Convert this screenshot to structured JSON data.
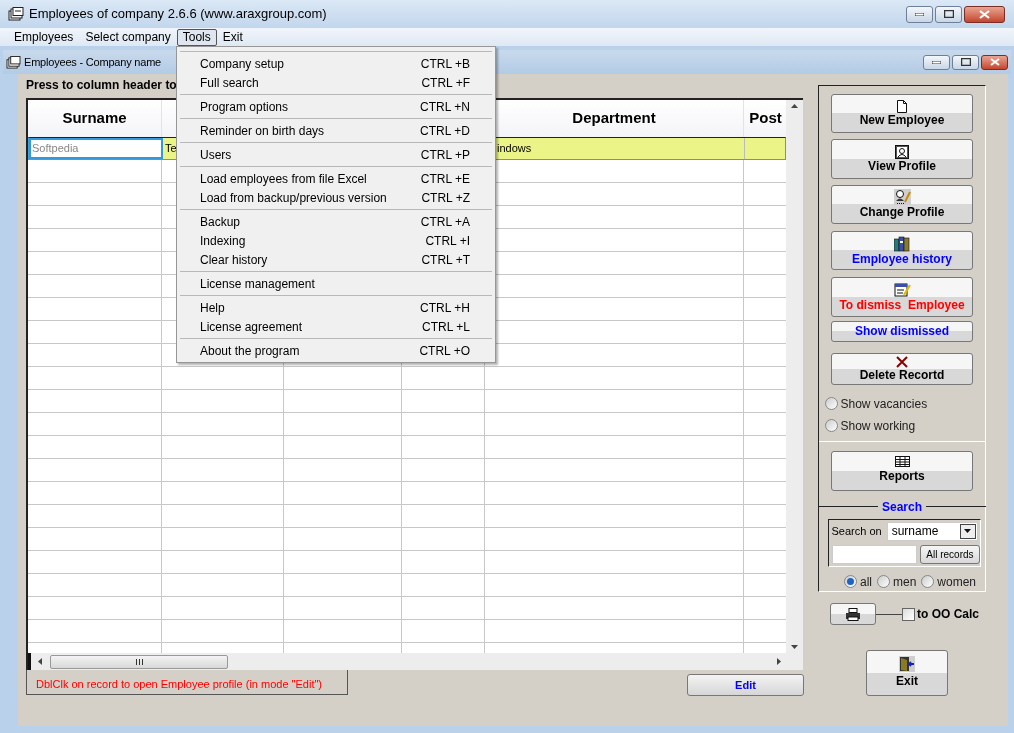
{
  "window": {
    "title": "Employees of company 2.6.6 (www.araxgroup.com)"
  },
  "menu_bar": [
    {
      "label": "Employees",
      "selected": false
    },
    {
      "label": "Select company",
      "selected": false
    },
    {
      "label": "Tools",
      "selected": true
    },
    {
      "label": "Exit",
      "selected": false
    }
  ],
  "tools_menu": {
    "groups": [
      [
        {
          "label": "Company setup",
          "shortcut": "CTRL +B"
        },
        {
          "label": "Full search",
          "shortcut": "CTRL +F"
        }
      ],
      [
        {
          "label": "Program options",
          "shortcut": "CTRL +N"
        }
      ],
      [
        {
          "label": "Reminder on birth days",
          "shortcut": "CTRL +D"
        }
      ],
      [
        {
          "label": "Users",
          "shortcut": "CTRL +P"
        }
      ],
      [
        {
          "label": "Load employees from file Excel",
          "shortcut": "CTRL +E"
        },
        {
          "label": "Load from backup/previous version",
          "shortcut": "CTRL +Z"
        }
      ],
      [
        {
          "label": "Backup",
          "shortcut": "CTRL +A"
        },
        {
          "label": "Indexing",
          "shortcut": "CTRL +I"
        },
        {
          "label": "Clear history",
          "shortcut": "CTRL +T"
        }
      ],
      [
        {
          "label": "License management"
        }
      ],
      [
        {
          "label": "Help",
          "shortcut": "CTRL +H"
        },
        {
          "label": "License agreement",
          "shortcut": "CTRL +L"
        }
      ],
      [
        {
          "label": "About the program",
          "shortcut": "CTRL +O"
        }
      ]
    ]
  },
  "child_window": {
    "title": "Employees - Company name"
  },
  "table_hint": "Press to column header to",
  "table": {
    "columns": [
      {
        "label": "Surname"
      },
      {},
      {},
      {},
      {
        "label": "Department"
      },
      {
        "label": "Post"
      }
    ],
    "rows": [
      {
        "selected": true,
        "cells": [
          "Softpedia",
          "Te",
          null,
          null,
          "indows",
          null
        ]
      }
    ]
  },
  "status_hint": "DblClk on record to open Employee profile (in mode \"Edit\")",
  "edit_button": "Edit",
  "side_buttons": [
    {
      "label": "New Employee",
      "kind": "icon",
      "color": "#000000"
    },
    {
      "label": "View Profile",
      "kind": "icon",
      "color": "#000000"
    },
    {
      "label": "Change Profile",
      "kind": "icon",
      "color": "#000000"
    },
    {
      "label": "Employee history",
      "kind": "icon",
      "color": "#0000ff"
    },
    {
      "label": "To dismiss  Employee",
      "kind": "icon",
      "color": "#ff0000"
    },
    {
      "label": "Show dismissed",
      "kind": "plain",
      "color": "#0000ff"
    },
    {
      "label": "Delete Recortd",
      "kind": "icon",
      "color": "#000000"
    }
  ],
  "filters": [
    {
      "label": "Show vacancies",
      "selected": false
    },
    {
      "label": "Show working",
      "selected": false
    }
  ],
  "reports_button": "Reports",
  "search": {
    "title": "Search",
    "label": "Search on",
    "field": "surname",
    "all_records_button": "All records",
    "gender": [
      {
        "label": "all",
        "selected": true
      },
      {
        "label": "men",
        "selected": false
      },
      {
        "label": "women",
        "selected": false
      }
    ]
  },
  "export": {
    "label": "to OO Calc",
    "checked": false
  },
  "exit_button": "Exit"
}
